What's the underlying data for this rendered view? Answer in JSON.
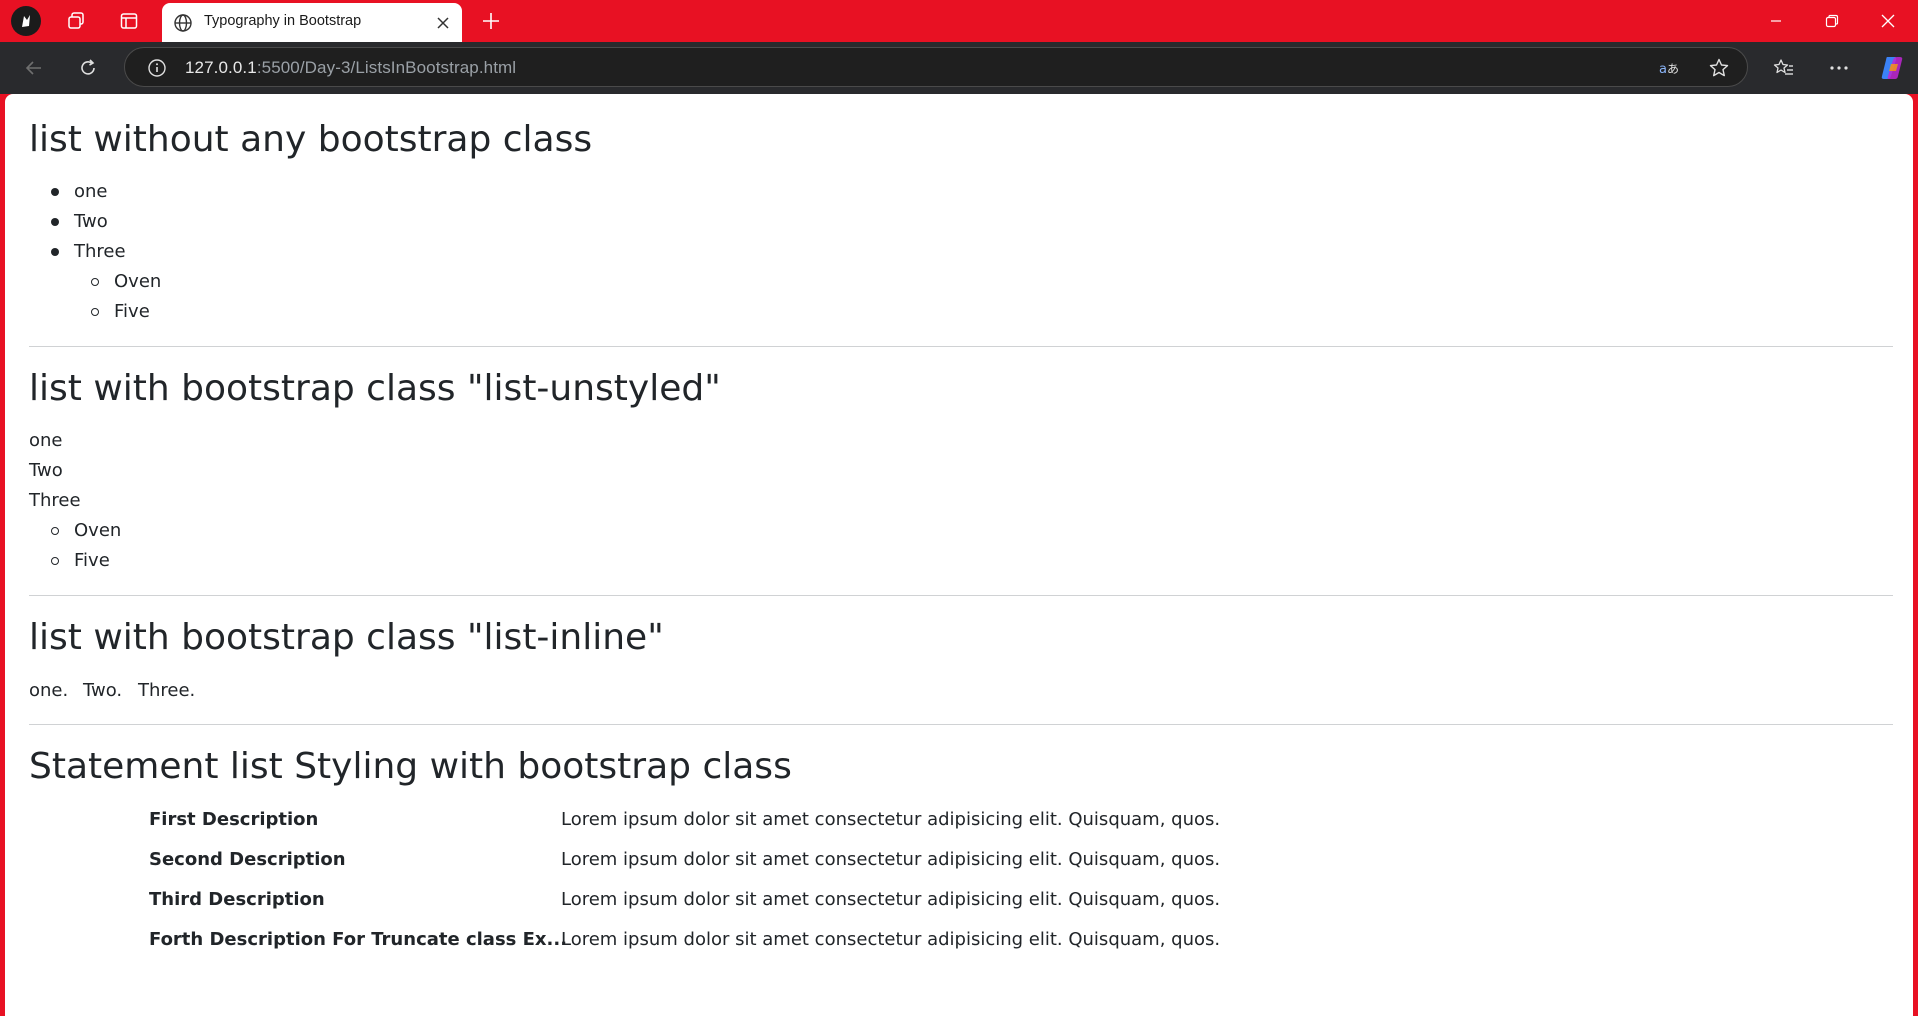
{
  "browser": {
    "tab_title": "Typography in Bootstrap",
    "url_host": "127.0.0.1",
    "url_rest": ":5500/Day-3/ListsInBootstrap.html"
  },
  "page": {
    "section1": {
      "heading": "list without any bootstrap class",
      "items": [
        "one",
        "Two",
        "Three"
      ],
      "nested": [
        "Oven",
        "Five"
      ]
    },
    "section2": {
      "heading": "list with bootstrap class \"list-unstyled\"",
      "items": [
        "one",
        "Two",
        "Three"
      ],
      "nested": [
        "Oven",
        "Five"
      ]
    },
    "section3": {
      "heading": "list with bootstrap class \"list-inline\"",
      "items": [
        "one.",
        "Two.",
        "Three."
      ]
    },
    "section4": {
      "heading": "Statement list Styling with bootstrap class",
      "rows": [
        {
          "term": "First Description",
          "desc": "Lorem ipsum dolor sit amet consectetur adipisicing elit. Quisquam, quos."
        },
        {
          "term": "Second Description",
          "desc": "Lorem ipsum dolor sit amet consectetur adipisicing elit. Quisquam, quos."
        },
        {
          "term": "Third Description",
          "desc": "Lorem ipsum dolor sit amet consectetur adipisicing elit. Quisquam, quos."
        },
        {
          "term": "Forth Description For Truncate class Ex...",
          "desc": "Lorem ipsum dolor sit amet consectetur adipisicing elit. Quisquam, quos."
        }
      ]
    }
  },
  "colors": {
    "titlebar": "#e81123",
    "toolbar": "#292a2d",
    "text": "#212529"
  }
}
